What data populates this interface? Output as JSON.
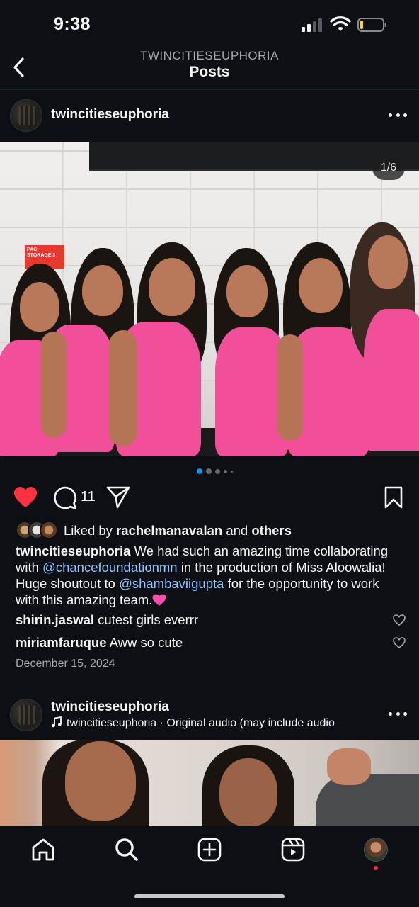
{
  "status_bar": {
    "time": "9:38"
  },
  "header": {
    "account": "TWINCITIESEUPHORIA",
    "title": "Posts"
  },
  "post1": {
    "username": "twincitieseuphoria",
    "image_counter": "1/6",
    "image_sign_text": "PAC STORAGE 3",
    "carousel": {
      "total_dots": 5,
      "active_index": 0
    },
    "comment_count": "11",
    "liked": true,
    "likes": {
      "prefix": "Liked by ",
      "user": "rachelmanavalan",
      "middle": " and ",
      "others": "others"
    },
    "caption": {
      "user": "twincitieseuphoria",
      "text1": " We had such an amazing time collaborating with ",
      "mention1": "@chancefoundationmn",
      "text2": " in the production of Miss Aloowalia! Huge shoutout to ",
      "mention2": "@shambaviigupta",
      "text3": " for the opportunity to work with this amazing team."
    },
    "comments": [
      {
        "user": "shirin.jaswal",
        "text": " cutest girls everrr"
      },
      {
        "user": "miriamfaruque",
        "text": " Aww so cute"
      }
    ],
    "date": "December 15, 2024"
  },
  "post2": {
    "username": "twincitieseuphoria",
    "audio": "twincitieseuphoria · Original audio  (may include audio"
  },
  "colors": {
    "background": "#0c1014",
    "heart_red": "#ff3040",
    "mention_blue": "#8ec5ff",
    "carousel_active": "#0095f6",
    "tank_top_pink": "#f24f9a"
  },
  "icons": {
    "back": "chevron-left-icon",
    "like": "heart-filled-icon",
    "comment": "comment-bubble-icon",
    "share": "paper-plane-icon",
    "save": "bookmark-icon",
    "nav": [
      "home-icon",
      "search-icon",
      "create-icon",
      "reels-icon",
      "profile-avatar"
    ]
  }
}
